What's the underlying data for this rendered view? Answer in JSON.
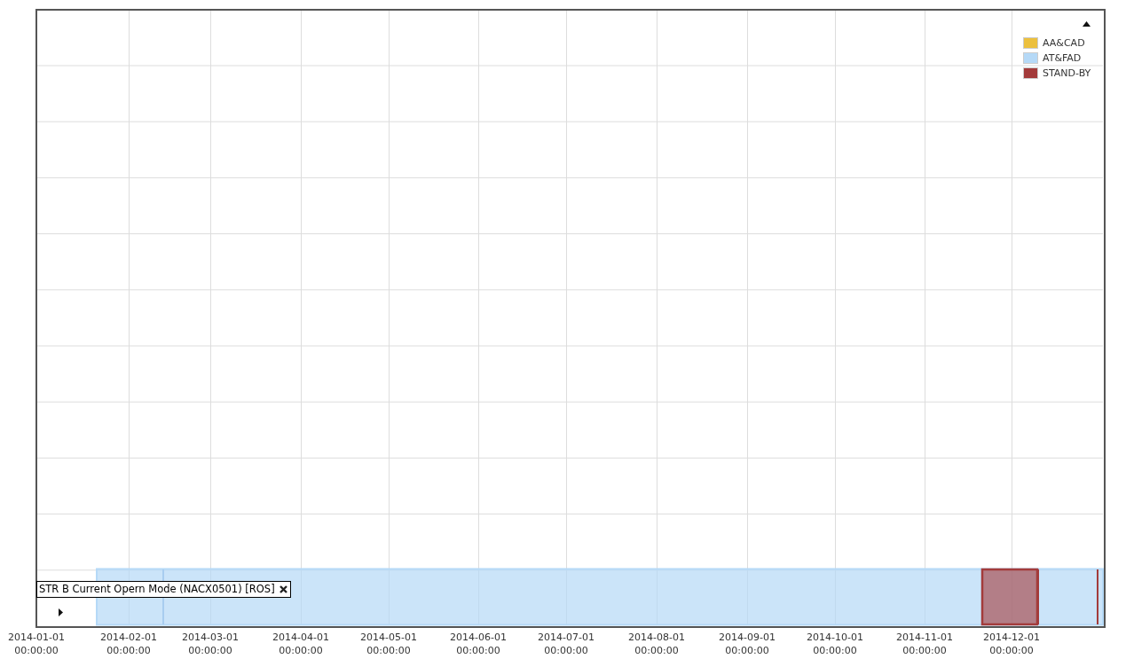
{
  "legend": {
    "expanded": true,
    "items": [
      {
        "label": "AA&CAD",
        "color": "#ecc03e"
      },
      {
        "label": "AT&FAD",
        "color": "#b5d9f7"
      },
      {
        "label": "STAND-BY",
        "color": "#a33b3b"
      }
    ]
  },
  "row": {
    "label": "STR B Current Opern Mode (NACX0501) [ROS]",
    "expanded": false
  },
  "x_axis": {
    "ticks": [
      {
        "date": "2014-01-01",
        "time": "00:00:00"
      },
      {
        "date": "2014-02-01",
        "time": "00:00:00"
      },
      {
        "date": "2014-03-01",
        "time": "00:00:00"
      },
      {
        "date": "2014-04-01",
        "time": "00:00:00"
      },
      {
        "date": "2014-05-01",
        "time": "00:00:00"
      },
      {
        "date": "2014-06-01",
        "time": "00:00:00"
      },
      {
        "date": "2014-07-01",
        "time": "00:00:00"
      },
      {
        "date": "2014-08-01",
        "time": "00:00:00"
      },
      {
        "date": "2014-09-01",
        "time": "00:00:00"
      },
      {
        "date": "2014-10-01",
        "time": "00:00:00"
      },
      {
        "date": "2014-11-01",
        "time": "00:00:00"
      },
      {
        "date": "2014-12-01",
        "time": "00:00:00"
      }
    ]
  }
}
